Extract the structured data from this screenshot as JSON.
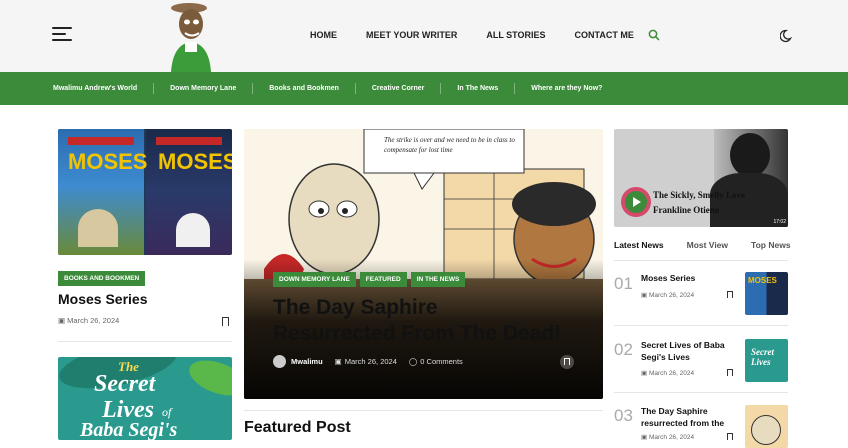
{
  "header": {
    "menu_icon": "hamburger-icon",
    "nav": [
      "HOME",
      "MEET YOUR WRITER",
      "ALL STORIES",
      "CONTACT ME"
    ],
    "search_icon": "search-icon",
    "theme_icon": "moon-icon"
  },
  "categories": [
    "Mwalimu Andrew's World",
    "Down Memory Lane",
    "Books and Bookmen",
    "Creative Corner",
    "In The News",
    "Where are they Now?"
  ],
  "left": {
    "card1": {
      "tag": "BOOKS AND BOOKMEN",
      "title": "Moses Series",
      "date": "March 26, 2024"
    },
    "card2_img_text": [
      "The",
      "Secret",
      "Lives",
      "of",
      "Baba Segi's"
    ]
  },
  "hero": {
    "tags": [
      "DOWN MEMORY LANE",
      "FEATURED",
      "IN THE NEWS"
    ],
    "title_line1": "The Day Saphire",
    "title_line2": "Resurrected From The Dead!",
    "author": "Mwalimu",
    "date": "March 26, 2024",
    "comments": "0 Comments",
    "speech": "The strike is over and we need to be in class to compensate for lost time"
  },
  "featured_heading": "Featured Post",
  "video": {
    "title_line1": "The Sickly, Smelly Love",
    "title_line2": "Frankline Otieno",
    "duration": "17:02"
  },
  "tabs": [
    "Latest News",
    "Most View",
    "Top News"
  ],
  "latest": [
    {
      "num": "01",
      "title": "Moses Series",
      "date": "March 26, 2024"
    },
    {
      "num": "02",
      "title": "Secret Lives of Baba Segi's Lives",
      "date": "March 26, 2024"
    },
    {
      "num": "03",
      "title": "The Day Saphire resurrected from the",
      "date": "March 26, 2024"
    }
  ],
  "colors": {
    "accent": "#3b8b3a",
    "header_bg": "#f5f5f5",
    "hero_overlay": "#111111"
  }
}
